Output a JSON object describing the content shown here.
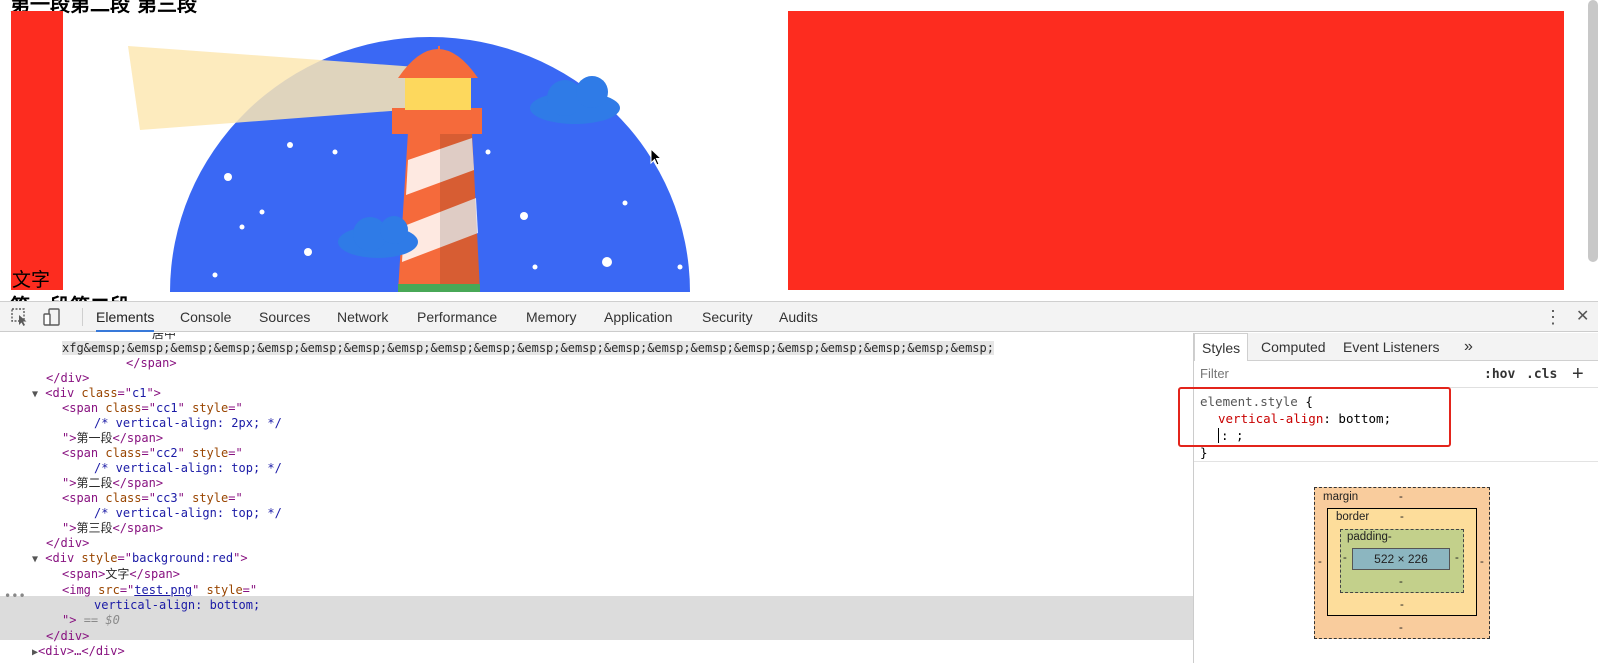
{
  "page": {
    "top_cut_text": "第一段第二段 第三段",
    "red_column_label": "文字",
    "bottom_cut_text": "第一段第二段"
  },
  "colors": {
    "red": "#fd2c1f",
    "lighthouse_sky": "#3a68f4",
    "accent": "#3879d9",
    "highlight_box": "#e3241b"
  },
  "toolbar": {
    "inspect_icon": "inspect-element-icon",
    "device_icon": "device-toolbar-icon",
    "tabs": [
      "Elements",
      "Console",
      "Sources",
      "Network",
      "Performance",
      "Memory",
      "Application",
      "Security",
      "Audits"
    ],
    "active_tab": "Elements",
    "more_icon": "⋮",
    "close_icon": "✕"
  },
  "elements": {
    "lines": {
      "l0": "居中",
      "l1_text": "xfg&emsp;&emsp;&emsp;&emsp;&emsp;&emsp;&emsp;&emsp;&emsp;&emsp;&emsp;&emsp;&emsp;&emsp;&emsp;&emsp;&emsp;&emsp;&emsp;&emsp;&emsp;",
      "l2": "</span>",
      "l3": "</div>",
      "div_c1_tag": "div",
      "div_c1_attr": "class",
      "div_c1_val": "c1",
      "span": "span",
      "class": "class",
      "style": "style",
      "cc1": "cc1",
      "cc2": "cc2",
      "cc3": "cc3",
      "cmt1": "/* vertical-align: 2px; */",
      "cmt2": "/* vertical-align: top; */",
      "cmt3": "/* vertical-align: top; */",
      "text1": "第一段",
      "text2": "第二段",
      "text3": "第三段",
      "bg_attr": "style",
      "bg_val": "background:red",
      "span_text": "文字",
      "img_src_attr": "src",
      "img_src": "test.png",
      "img_style_val": "vertical-align: bottom;",
      "dollar0": "== $0",
      "collapsed_div": "<div>…</div>"
    }
  },
  "sidebar": {
    "tabs": [
      "Styles",
      "Computed",
      "Event Listeners"
    ],
    "more": "»",
    "filter_placeholder": "Filter",
    "hov": ":hov",
    "cls": ".cls",
    "plus": "+",
    "rule": {
      "selector": "element.style",
      "prop": "vertical-align",
      "value": "bottom",
      "editing": ": ;"
    },
    "box_model": {
      "margin_label": "margin",
      "border_label": "border",
      "padding_label": "padding-",
      "content": "522 × 226",
      "dash": "-"
    }
  }
}
